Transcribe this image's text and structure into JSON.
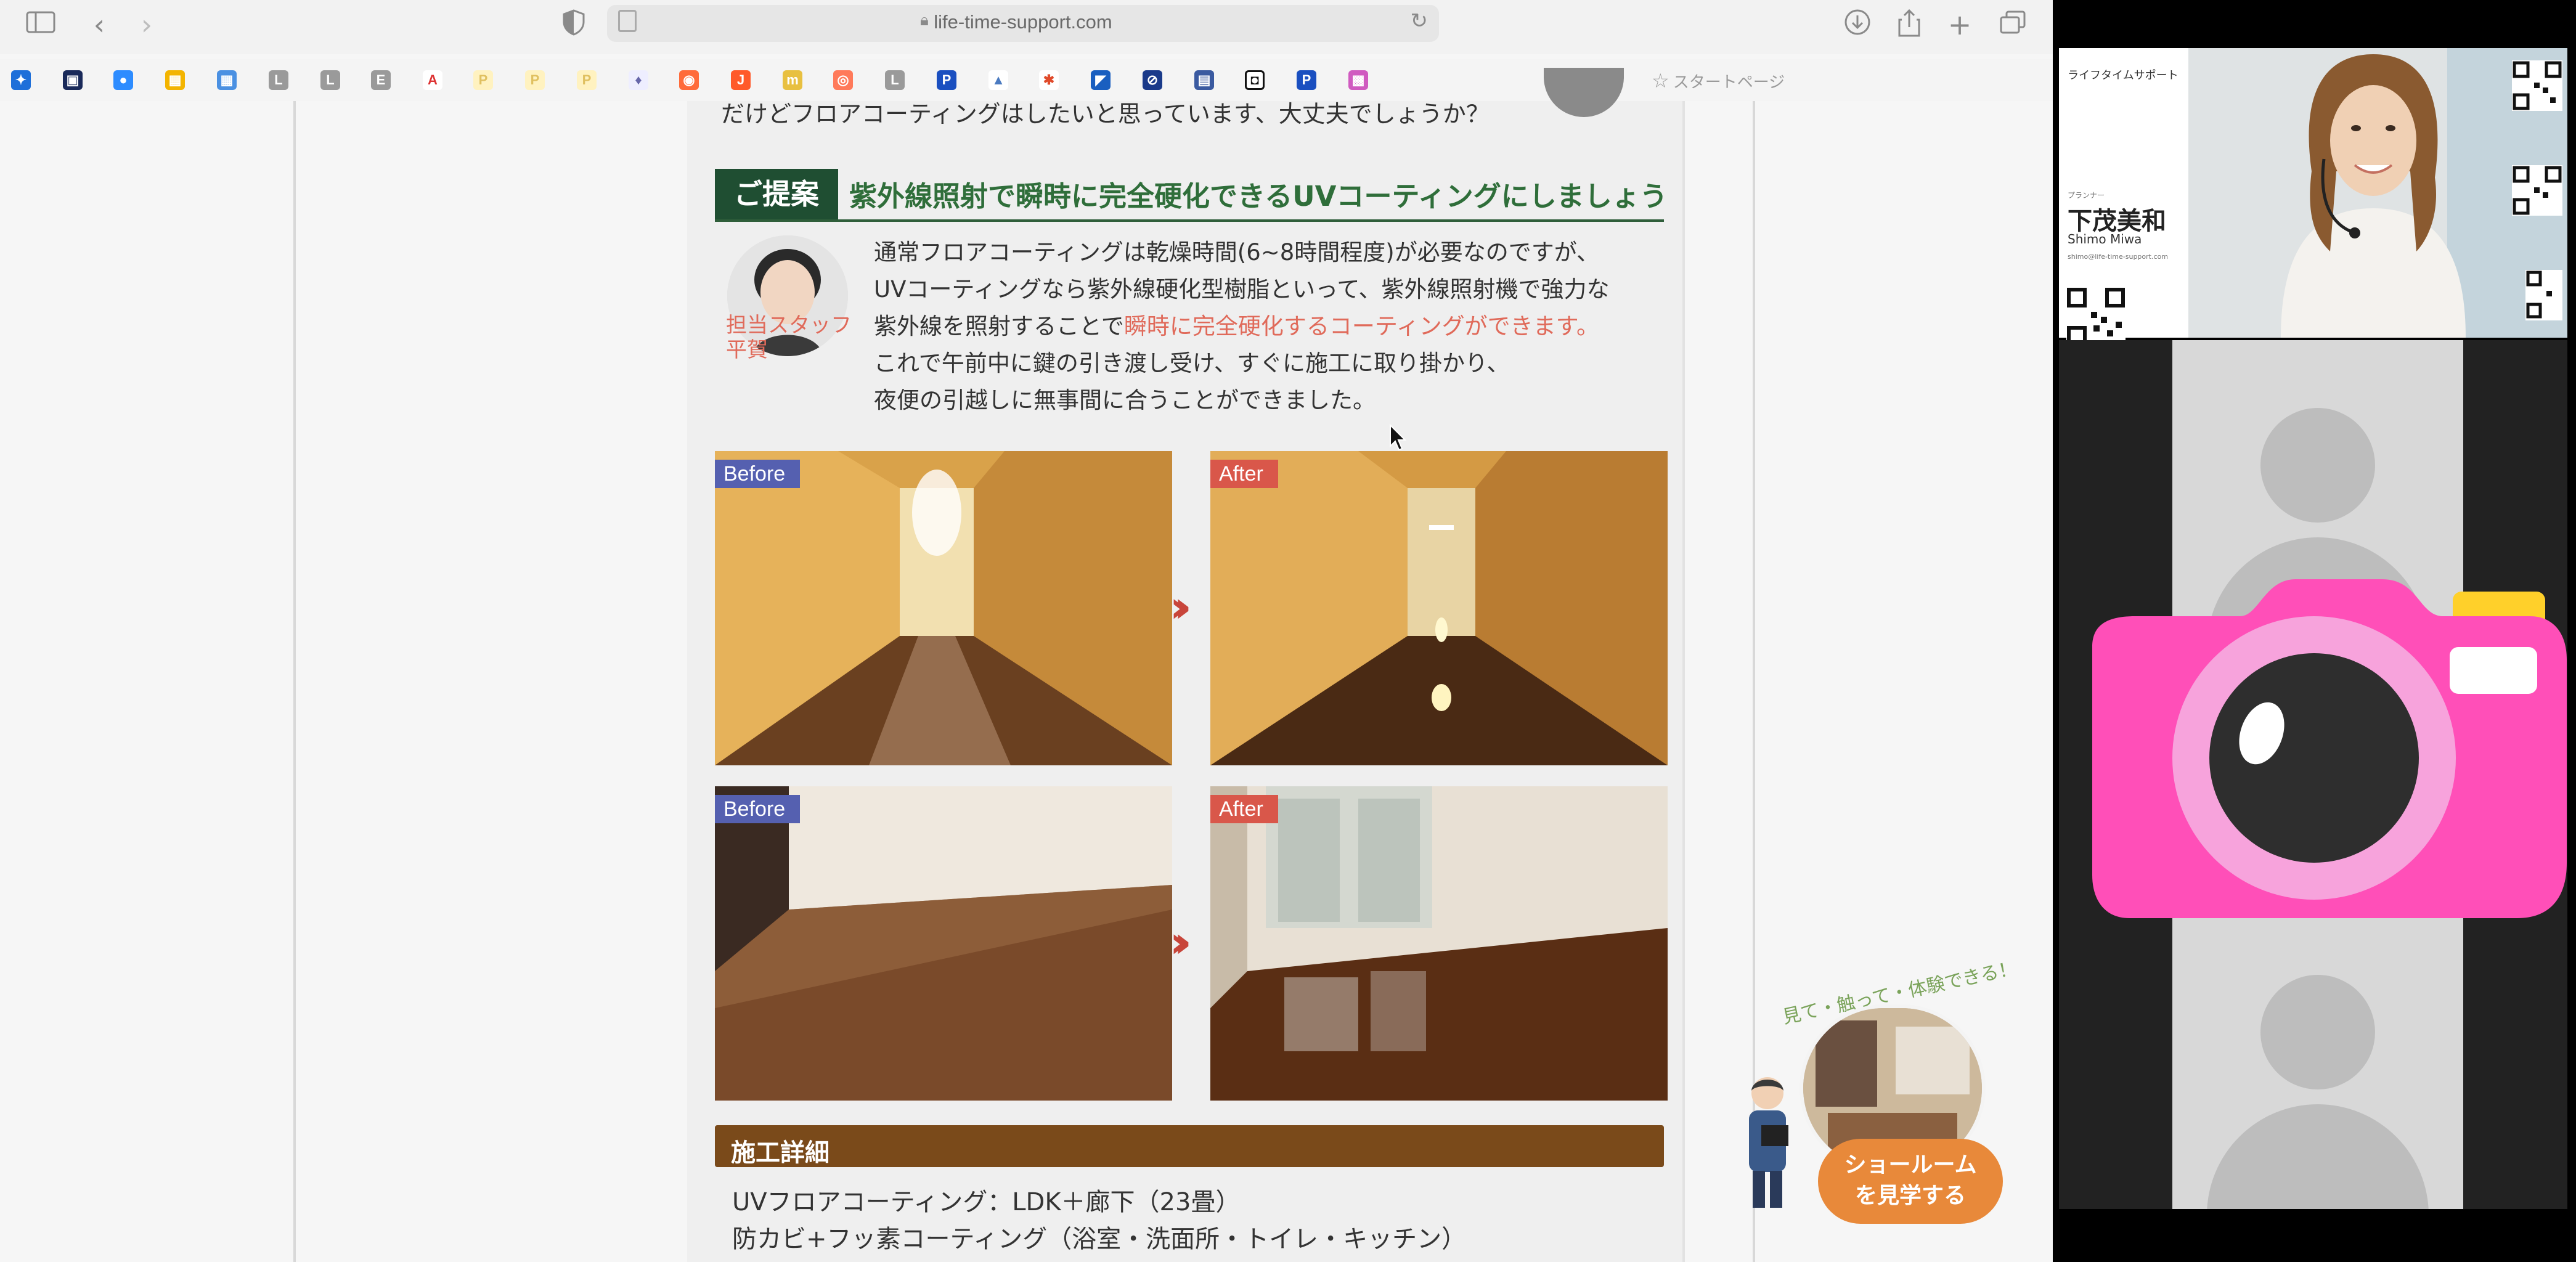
{
  "browser": {
    "url": "life-time-support.com",
    "start_page_label": "スタートページ",
    "toolbar_icons": [
      "sidebar-toggle-icon",
      "back-icon",
      "forward-icon",
      "shield-icon",
      "download-icon",
      "share-icon",
      "new-tab-icon",
      "tab-overview-icon"
    ]
  },
  "article": {
    "top_line": "だけどフロアコーティングはしたいと思っています、大丈夫でしょうか？",
    "proposal_tag": "ご提案",
    "proposal_title": "紫外線照射で瞬時に完全硬化できるUVコーティングにしましょう",
    "staff_caption_line1": "担当スタッフ",
    "staff_caption_line2": "平賀",
    "paragraph": {
      "line1": "通常フロアコーティングは乾燥時間(6~8時間程度)が必要なのですが、",
      "line2": "UVコーティングなら紫外線硬化型樹脂といって、紫外線照射機で強力な",
      "line3_plain": "紫外線を照射することで",
      "line3_highlight": "瞬時に完全硬化するコーティングができます。",
      "line4": "これで午前中に鍵の引き渡し受け、すぐに施工に取り掛かり、",
      "line5": "夜便の引越しに無事間に合うことができました。"
    },
    "photos": [
      {
        "label": "Before"
      },
      {
        "label": "After"
      },
      {
        "label": "Before"
      },
      {
        "label": "After"
      }
    ],
    "detail_title": "施工詳細",
    "detail_lines": [
      "UVフロアコーティング：LDK＋廊下（23畳）",
      "防カビ+フッ素コーティング（浴室・洗面所・トイレ・キッチン）"
    ],
    "showroom": {
      "arc_text": "見て・触って・体験できる！",
      "button_line1": "ショールーム",
      "button_line2": "を見学する"
    }
  },
  "meeting": {
    "namecard": {
      "company": "ライフタイムサポート",
      "role": "プランナー",
      "name_jp": "下茂美和",
      "name_en": "Shimo Miwa",
      "email": "shimo@life-time-support.com"
    }
  },
  "colors": {
    "proposal_green": "#1f4e32",
    "highlight_red": "#e06a5a",
    "detail_brown": "#7a4a1a",
    "camera_pink": "#ff4fb8",
    "showroom_orange": "#e8893a"
  }
}
